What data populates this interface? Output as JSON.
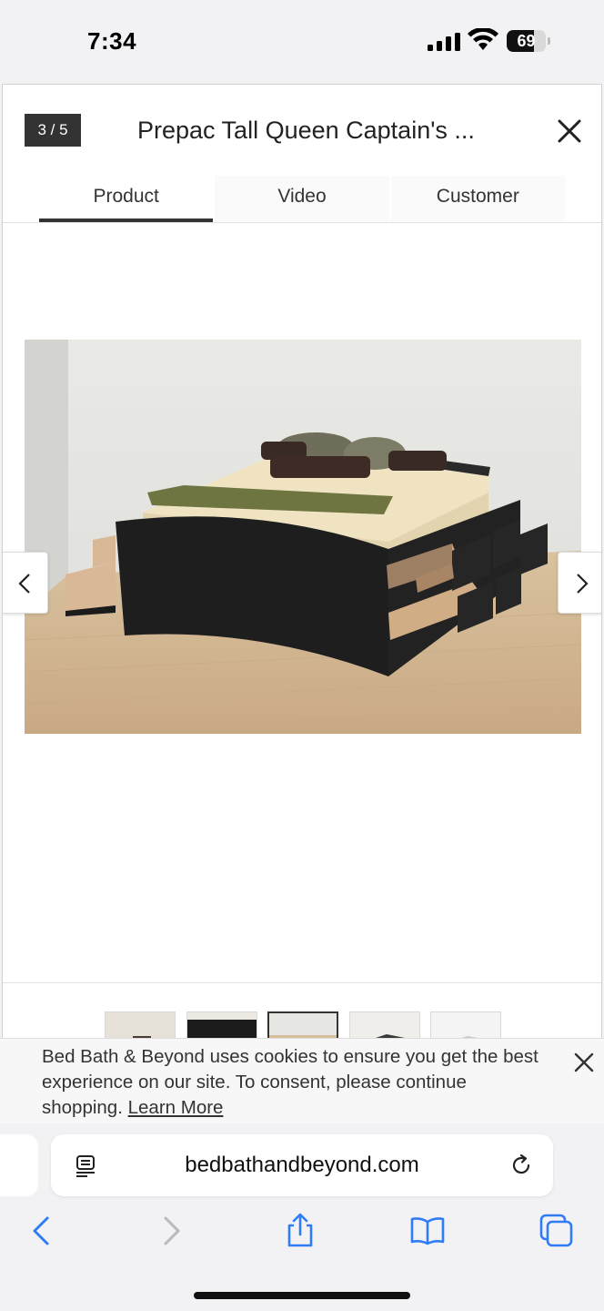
{
  "status_bar": {
    "time": "7:34",
    "battery_level": "69",
    "battery_fraction": 0.69
  },
  "modal": {
    "counter": "3 / 5",
    "title": "Prepac Tall Queen Captain's ...",
    "tabs": [
      {
        "label": "Product",
        "active": true
      },
      {
        "label": "Video",
        "active": false
      },
      {
        "label": "Customer",
        "active": false
      }
    ],
    "image_index_current": 3,
    "image_index_total": 5,
    "thumbnail_count": 5,
    "selected_thumbnail": 3
  },
  "cookie_banner": {
    "text": "Bed Bath & Beyond uses cookies to ensure you get the best experience on our site. To consent, please continue shopping.",
    "link_label": "Learn More"
  },
  "browser": {
    "url": "bedbathandbeyond.com"
  },
  "icons": {
    "close": "close-icon",
    "prev": "chevron-left-icon",
    "next": "chevron-right-icon",
    "reader": "reader-mode-icon",
    "reload": "reload-icon",
    "back": "back-icon",
    "forward": "forward-icon",
    "share": "share-icon",
    "bookmarks": "bookmarks-icon",
    "tabs": "tabs-icon"
  },
  "colors": {
    "accent_blue": "#2f7cf6",
    "tab_underline": "#333333",
    "counter_bg": "#333333"
  }
}
